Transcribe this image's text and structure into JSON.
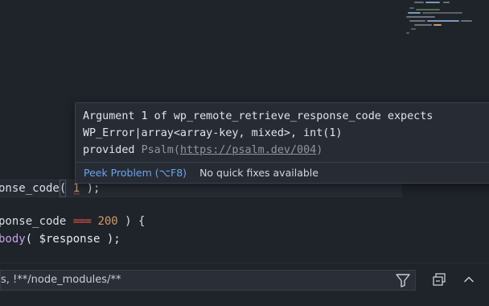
{
  "editor": {
    "lines": {
      "line1": {
        "fn_part": "onse_code",
        "open_paren": "(",
        "arg": "1",
        "close": ");"
      },
      "line2": {
        "prefix": "ponse_code ",
        "operator": "===",
        "value": "200",
        "suffix": " ) {"
      },
      "line3": {
        "fn_part": "body",
        "rest": "( $response );"
      }
    }
  },
  "hover": {
    "message_line1": "Argument 1 of wp_remote_retrieve_response_code expects",
    "message_line2": "WP_Error|array<array-key, mixed>, int(1)",
    "message_line3_prefix": "provided ",
    "source": "Psalm(",
    "link": "https://psalm.dev/004",
    "source_close": ")",
    "peek_label": "Peek Problem (⌥F8)",
    "no_fix_label": "No quick fixes available"
  },
  "problems_panel": {
    "filter_value": "s, !**/node_modules/**"
  },
  "colors": {
    "accent_link": "#6aa4ef",
    "error": "#e5534b",
    "number": "#d29b67",
    "background": "#1f232a"
  },
  "icons": {
    "filter": "filter-icon",
    "collapse": "collapse-all-icon",
    "chevron": "chevron-up-icon"
  }
}
